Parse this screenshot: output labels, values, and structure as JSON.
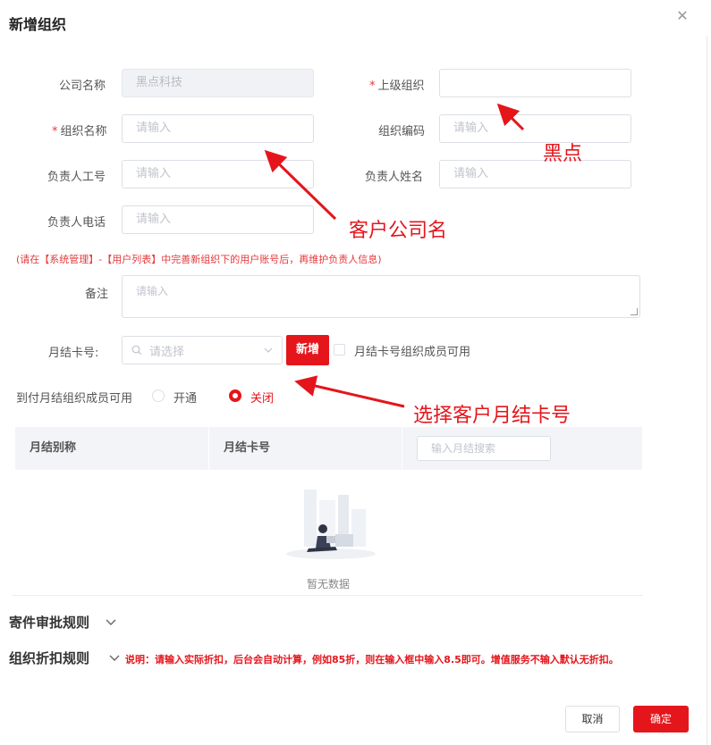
{
  "dialog": {
    "title": "新增组织",
    "close_glyph": "✕"
  },
  "form": {
    "company_name": {
      "label": "公司名称",
      "value": "黑点科技"
    },
    "parent_org": {
      "label": "上级组织",
      "required_mark": "*",
      "value": ""
    },
    "org_name": {
      "label": "组织名称",
      "required_mark": "*",
      "placeholder": "请输入"
    },
    "org_code": {
      "label": "组织编码",
      "placeholder": "请输入"
    },
    "manager_id": {
      "label": "负责人工号",
      "placeholder": "请输入"
    },
    "manager_name": {
      "label": "负责人姓名",
      "placeholder": "请输入"
    },
    "manager_phone": {
      "label": "负责人电话",
      "placeholder": "请输入"
    },
    "hint": "(请在【系统管理】-【用户列表】中完善新组织下的用户账号后，再维护负责人信息)",
    "remark": {
      "label": "备注",
      "placeholder": "请输入"
    },
    "monthly_card": {
      "label": "月结卡号:",
      "placeholder": "请选择",
      "add_button": "新增",
      "checkbox_label": "月结卡号组织成员可用",
      "checkbox_checked": false
    },
    "cod_available": {
      "label": "到付月结组织成员可用",
      "options": [
        "开通",
        "关闭"
      ],
      "selected": "关闭"
    }
  },
  "table": {
    "columns": [
      "月结别称",
      "月结卡号"
    ],
    "search_placeholder": "输入月结搜索",
    "empty_text": "暂无数据",
    "rows": []
  },
  "sections": {
    "approval_rules": "寄件审批规则",
    "discount_rules": "组织折扣规则",
    "discount_note": "说明：请输入实际折扣，后台会自动计算，例如85折，则在输入框中输入8.5即可。增值服务不输入默认无折扣。"
  },
  "footer": {
    "cancel": "取消",
    "ok": "确定"
  },
  "annotations": {
    "black_dot": "黑点",
    "client_company": "客户公司名",
    "select_card": "选择客户月结卡号"
  },
  "colors": {
    "accent": "#e4161c",
    "required": "#e4393c"
  },
  "icons": [
    "close-icon",
    "search-icon",
    "chevron-down-icon",
    "empty-illustration-icon",
    "arrow-icon"
  ]
}
